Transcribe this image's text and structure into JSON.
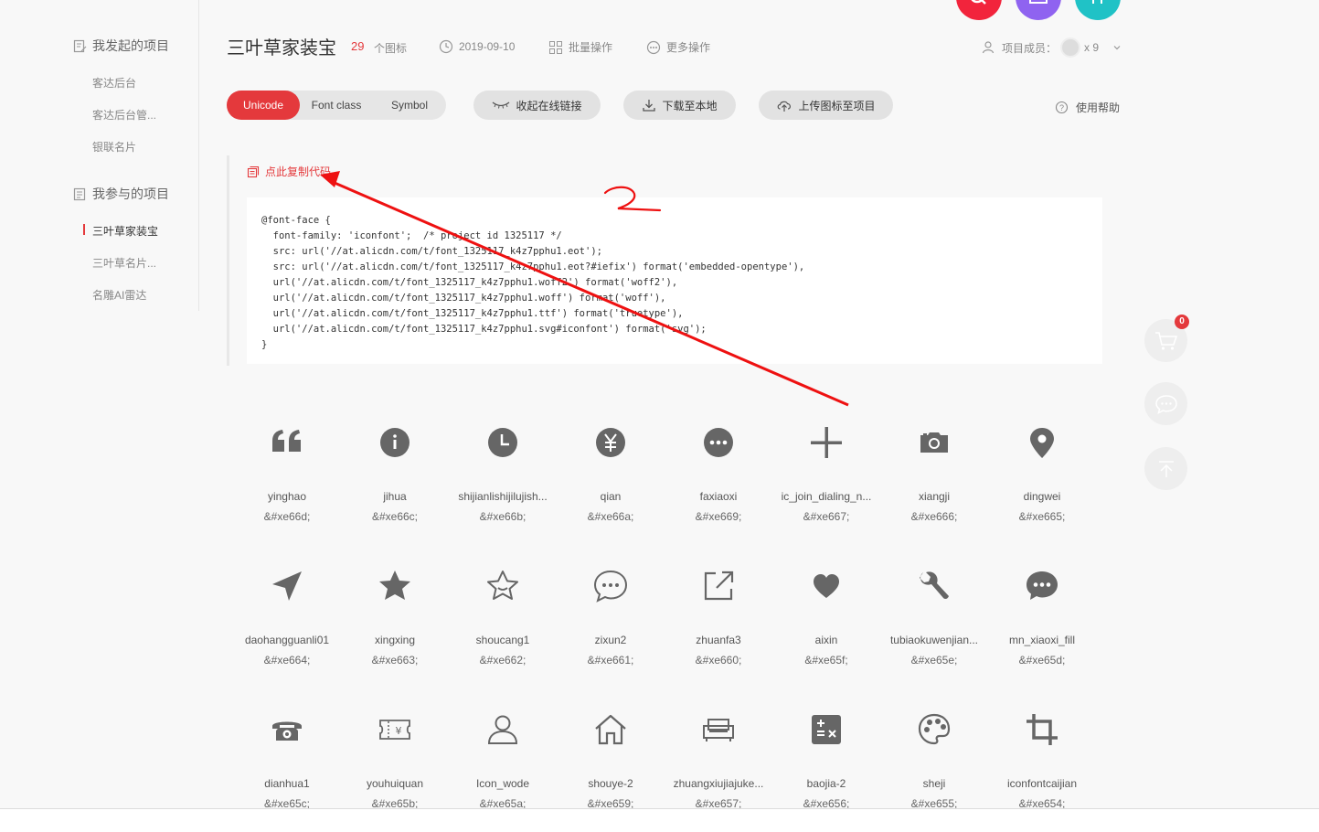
{
  "sidebar": {
    "my_projects_title": "我发起的项目",
    "my_projects": [
      "客达后台",
      "客达后台管...",
      "银联名片"
    ],
    "joined_projects_title": "我参与的项目",
    "joined_projects": [
      "三叶草家装宝",
      "三叶草名片...",
      "名雕AI雷达"
    ]
  },
  "header": {
    "title": "三叶草家装宝",
    "icon_count": "29",
    "icon_count_label": "个图标",
    "date": "2019-09-10",
    "batch_ops": "批量操作",
    "more_ops": "更多操作",
    "members_label": "项目成员：",
    "members_count": "x 9"
  },
  "toolbar": {
    "tabs": [
      "Unicode",
      "Font class",
      "Symbol"
    ],
    "collapse_link": "收起在线链接",
    "download": "下载至本地",
    "upload": "上传图标至项目",
    "help": "使用帮助"
  },
  "code_panel": {
    "copy_label": "点此复制代码",
    "lines": [
      "@font-face {",
      "  font-family: 'iconfont';  /* project id 1325117 */",
      "  src: url('//at.alicdn.com/t/font_1325117_k4z7pphu1.eot');",
      "  src: url('//at.alicdn.com/t/font_1325117_k4z7pphu1.eot?#iefix') format('embedded-opentype'),",
      "  url('//at.alicdn.com/t/font_1325117_k4z7pphu1.woff2') format('woff2'),",
      "  url('//at.alicdn.com/t/font_1325117_k4z7pphu1.woff') format('woff'),",
      "  url('//at.alicdn.com/t/font_1325117_k4z7pphu1.ttf') format('truetype'),",
      "  url('//at.alicdn.com/t/font_1325117_k4z7pphu1.svg#iconfont') format('svg');",
      "}"
    ]
  },
  "annotation_text": "2",
  "cart_badge": "0",
  "icons": [
    {
      "name": "yinghao",
      "code": "&#xe66d;",
      "icon": "quote-icon"
    },
    {
      "name": "jihua",
      "code": "&#xe66c;",
      "icon": "info-icon"
    },
    {
      "name": "shijianlishijilujish...",
      "code": "&#xe66b;",
      "icon": "clock-icon"
    },
    {
      "name": "qian",
      "code": "&#xe66a;",
      "icon": "yuan-icon"
    },
    {
      "name": "faxiaoxi",
      "code": "&#xe669;",
      "icon": "more-dots-icon"
    },
    {
      "name": "ic_join_dialing_n...",
      "code": "&#xe667;",
      "icon": "plus-icon"
    },
    {
      "name": "xiangji",
      "code": "&#xe666;",
      "icon": "camera-icon"
    },
    {
      "name": "dingwei",
      "code": "&#xe665;",
      "icon": "location-pin-icon"
    },
    {
      "name": "daohangguanli01",
      "code": "&#xe664;",
      "icon": "navigation-arrow-icon"
    },
    {
      "name": "xingxing",
      "code": "&#xe663;",
      "icon": "star-filled-icon"
    },
    {
      "name": "shoucang1",
      "code": "&#xe662;",
      "icon": "star-outline-icon"
    },
    {
      "name": "zixun2",
      "code": "&#xe661;",
      "icon": "chat-bubble-outline-icon"
    },
    {
      "name": "zhuanfa3",
      "code": "&#xe660;",
      "icon": "share-icon"
    },
    {
      "name": "aixin",
      "code": "&#xe65f;",
      "icon": "heart-icon"
    },
    {
      "name": "tubiaokuwenjian...",
      "code": "&#xe65e;",
      "icon": "wrench-icon"
    },
    {
      "name": "mn_xiaoxi_fill",
      "code": "&#xe65d;",
      "icon": "chat-bubble-filled-icon"
    },
    {
      "name": "dianhua1",
      "code": "&#xe65c;",
      "icon": "telephone-icon"
    },
    {
      "name": "youhuiquan",
      "code": "&#xe65b;",
      "icon": "coupon-icon"
    },
    {
      "name": "Icon_wode",
      "code": "&#xe65a;",
      "icon": "user-icon"
    },
    {
      "name": "shouye-2",
      "code": "&#xe659;",
      "icon": "home-icon"
    },
    {
      "name": "zhuangxiujiajuke...",
      "code": "&#xe657;",
      "icon": "sofa-icon"
    },
    {
      "name": "baojia-2",
      "code": "&#xe656;",
      "icon": "calculator-icon"
    },
    {
      "name": "sheji",
      "code": "&#xe655;",
      "icon": "palette-icon"
    },
    {
      "name": "iconfontcaijian",
      "code": "&#xe654;",
      "icon": "crop-icon"
    }
  ]
}
